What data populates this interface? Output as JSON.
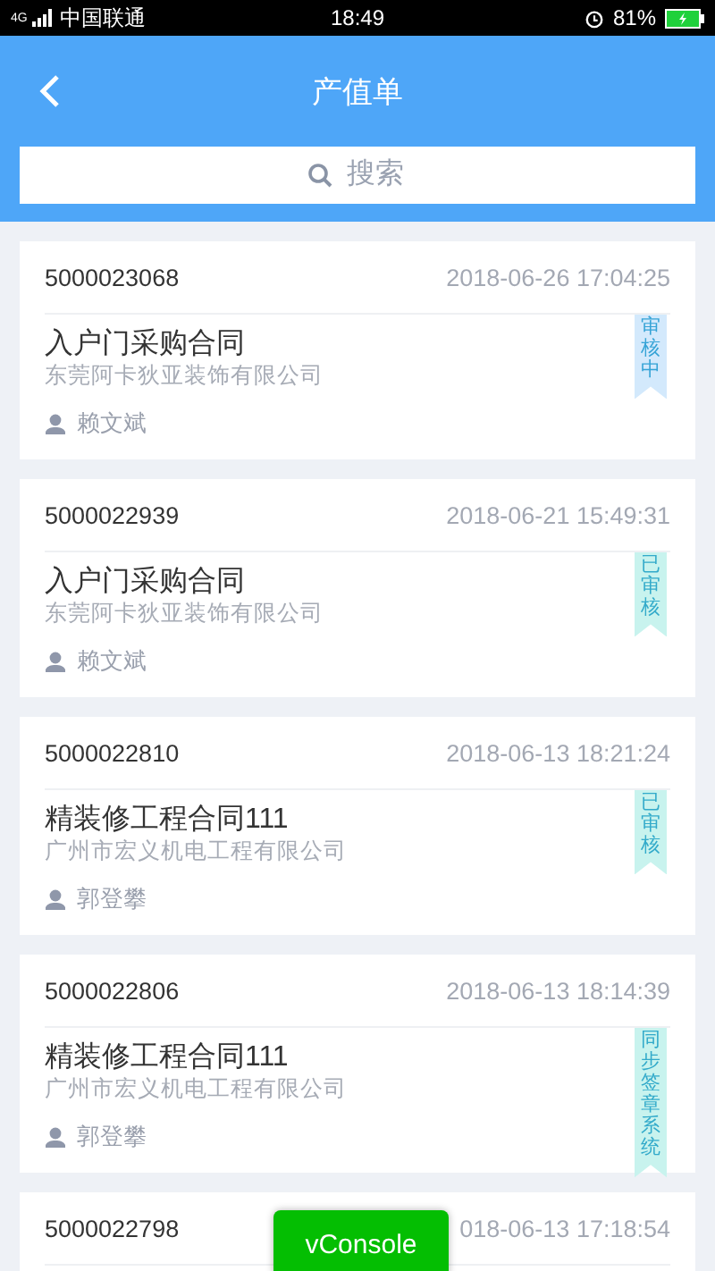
{
  "status_bar": {
    "network": "4G",
    "carrier": "中国联通",
    "time": "18:49",
    "battery": "81%"
  },
  "header": {
    "title": "产值单"
  },
  "search": {
    "placeholder": "搜索"
  },
  "orders": [
    {
      "number": "5000023068",
      "date": "2018-06-26 17:04:25",
      "title": "入户门采购合同",
      "company": "东莞阿卡狄亚装饰有限公司",
      "person": "赖文斌",
      "status": "审核中",
      "color": "#d3e9fc"
    },
    {
      "number": "5000022939",
      "date": "2018-06-21 15:49:31",
      "title": "入户门采购合同",
      "company": "东莞阿卡狄亚装饰有限公司",
      "person": "赖文斌",
      "status": "已审核",
      "color": "#c8f3ee"
    },
    {
      "number": "5000022810",
      "date": "2018-06-13 18:21:24",
      "title": "精装修工程合同111",
      "company": "广州市宏义机电工程有限公司",
      "person": "郭登攀",
      "status": "已审核",
      "color": "#c8f3ee"
    },
    {
      "number": "5000022806",
      "date": "2018-06-13 18:14:39",
      "title": "精装修工程合同111",
      "company": "广州市宏义机电工程有限公司",
      "person": "郭登攀",
      "status": "同步签章系统",
      "color": "#c8f3ee"
    },
    {
      "number": "5000022798",
      "date": "018-06-13 17:18:54"
    }
  ],
  "console_button": {
    "label": "vConsole"
  }
}
